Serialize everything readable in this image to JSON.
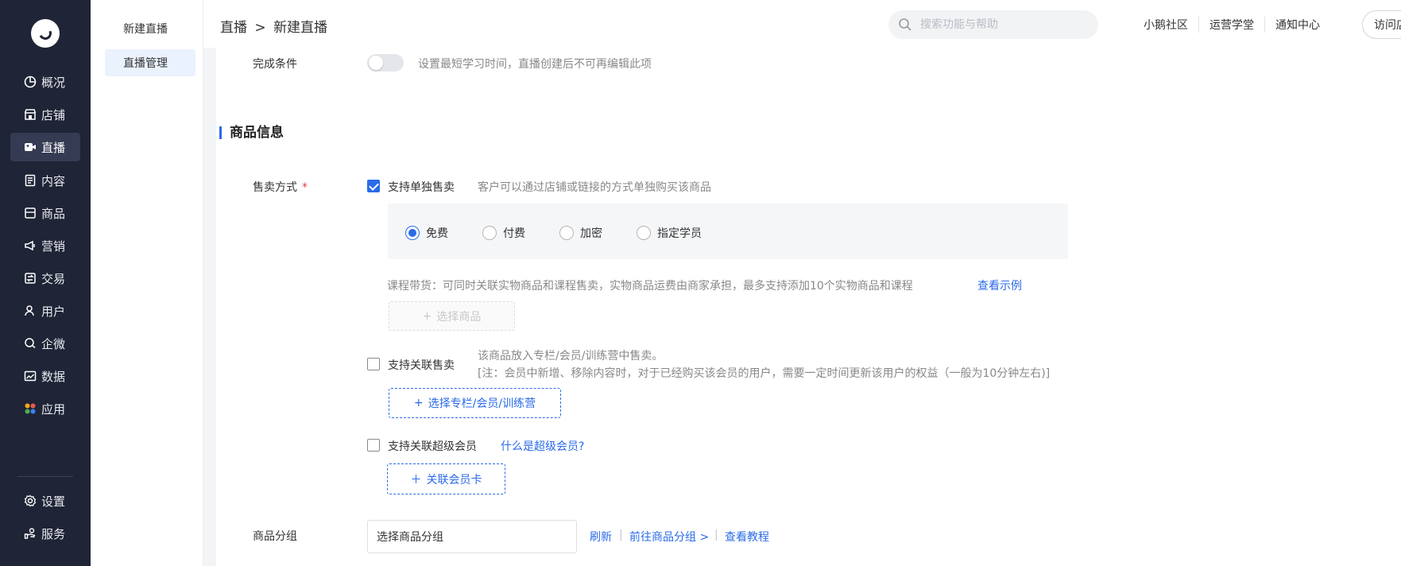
{
  "nav": {
    "items": [
      {
        "label": "概况",
        "icon": "dashboard-icon"
      },
      {
        "label": "店铺",
        "icon": "store-icon"
      },
      {
        "label": "直播",
        "icon": "live-icon",
        "active": true
      },
      {
        "label": "内容",
        "icon": "content-icon"
      },
      {
        "label": "商品",
        "icon": "product-icon"
      },
      {
        "label": "营销",
        "icon": "marketing-icon"
      },
      {
        "label": "交易",
        "icon": "trade-icon"
      },
      {
        "label": "用户",
        "icon": "user-icon"
      },
      {
        "label": "企微",
        "icon": "wecom-icon"
      },
      {
        "label": "数据",
        "icon": "data-icon"
      },
      {
        "label": "应用",
        "icon": "apps-icon"
      },
      {
        "label": "设置",
        "icon": "settings-icon"
      },
      {
        "label": "服务",
        "icon": "service-icon"
      }
    ]
  },
  "subnav": {
    "items": [
      {
        "label": "新建直播"
      },
      {
        "label": "直播管理",
        "active": true
      }
    ]
  },
  "header": {
    "breadcrumb": {
      "parent": "直播",
      "separator": ">",
      "current": "新建直播"
    },
    "search_placeholder": "搜索功能与帮助",
    "links": [
      "小鹅社区",
      "运营学堂",
      "通知中心"
    ],
    "visit_label": "访问店铺"
  },
  "form": {
    "completion": {
      "label": "完成条件",
      "hint": "设置最短学习时间，直播创建后不可再编辑此项",
      "enabled": false
    },
    "section_title": "商品信息",
    "sale_mode": {
      "label": "售卖方式",
      "required_mark": "*",
      "single_sale": {
        "label": "支持单独售卖",
        "checked": true,
        "hint": "客户可以通过店铺或链接的方式单独购买该商品",
        "options": [
          "免费",
          "付费",
          "加密",
          "指定学员"
        ],
        "selected": "免费"
      },
      "course_goods": {
        "hint": "课程带货：可同时关联实物商品和课程售卖，实物商品运费由商家承担，最多支持添加10个实物商品和课程",
        "example_link": "查看示例",
        "select_button": "选择商品"
      },
      "related_sale": {
        "label": "支持关联售卖",
        "checked": false,
        "hint_line1": "该商品放入专栏/会员/训练营中售卖。",
        "hint_line2": "[注：会员中新增、移除内容时，对于已经购买该会员的用户，需要一定时间更新该用户的权益（一般为10分钟左右)]",
        "select_button": "选择专栏/会员/训练营"
      },
      "super_member": {
        "label": "支持关联超级会员",
        "checked": false,
        "help_link": "什么是超级会员?",
        "button": "关联会员卡"
      }
    },
    "product_group": {
      "label": "商品分组",
      "value": "选择商品分组",
      "refresh": "刷新",
      "goto": "前往商品分组 >",
      "tutorial": "查看教程"
    }
  },
  "colors": {
    "nav_bg": "#1f2436",
    "accent": "#2a6be8",
    "required": "#e04040"
  }
}
